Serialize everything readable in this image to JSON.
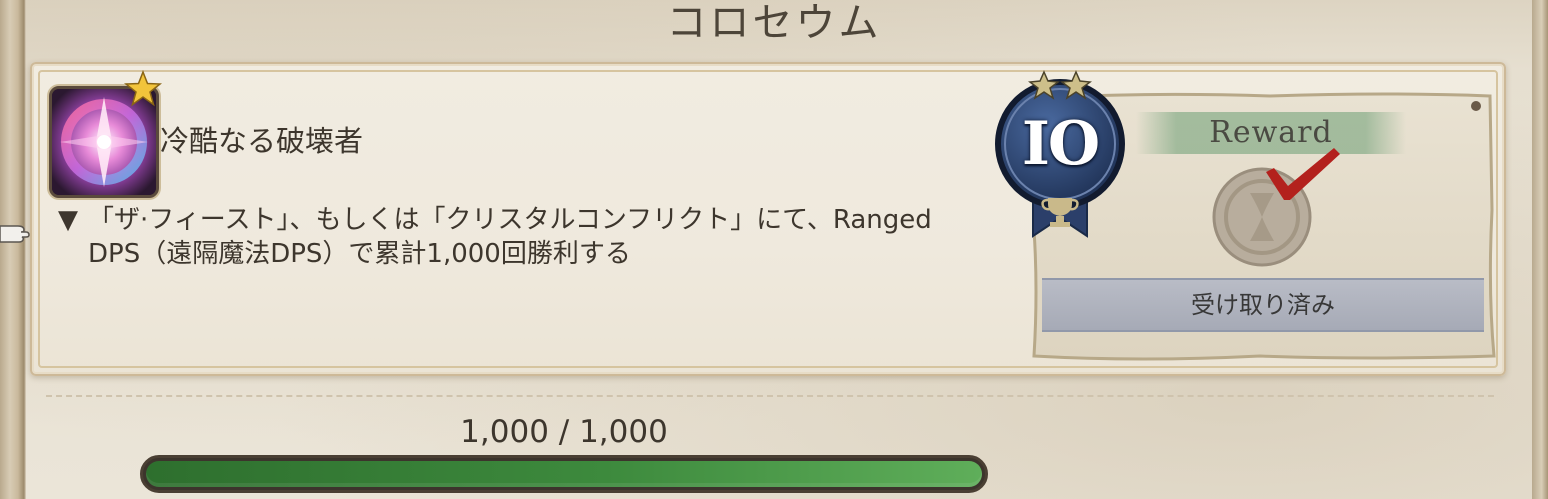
{
  "page": {
    "title": "コロセウム"
  },
  "achievement": {
    "icon": "crystal-sword-icon",
    "title": "冷酷なる破壊者",
    "description_line1": "「ザ·フィースト」、もしくは「クリスタルコンフリクト」にて、Ranged",
    "description_line2": "DPS（遠隔魔法DPS）で累計1,000回勝利する",
    "points": "IO",
    "points_icon": "trophy-icon"
  },
  "reward": {
    "title": "Reward",
    "status": "受け取り済み",
    "check_icon": "checkmark-icon"
  },
  "progress": {
    "text": "1,000 / 1,000",
    "current": 1000,
    "total": 1000
  },
  "colors": {
    "progress_fill": "#3d8a3d",
    "check": "#b3211d",
    "medal": "#2f4a78"
  }
}
